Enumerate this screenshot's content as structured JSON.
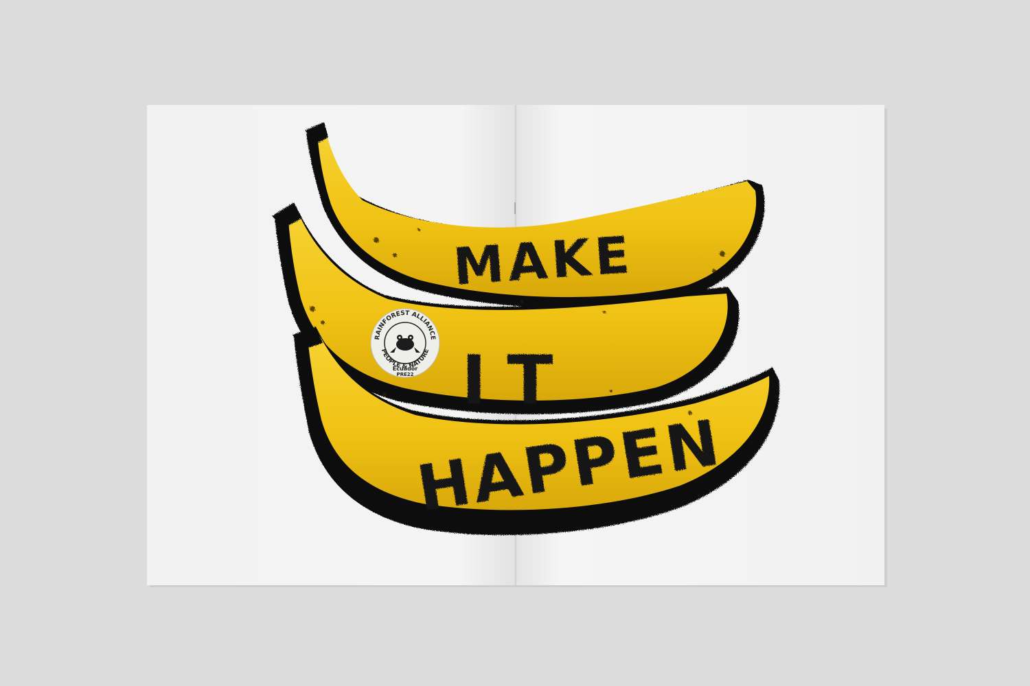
{
  "scene": {
    "background_color": "#dcdcdc",
    "paper_color": "#f4f4f4",
    "banana_color": "#f1c30f",
    "banana_shade_color": "#c89a0a",
    "ink_color": "#111111"
  },
  "carved_text": {
    "line1": "MAKE",
    "line2": "IT",
    "line3": "HAPPEN"
  },
  "sticker": {
    "ring_text_top": "RAINFOREST ALLIANCE",
    "ring_text_bottom": "PEOPLE & NATURE",
    "center_icon": "frog-icon",
    "origin_text": "Ecuador",
    "code_text": "PRE22"
  }
}
